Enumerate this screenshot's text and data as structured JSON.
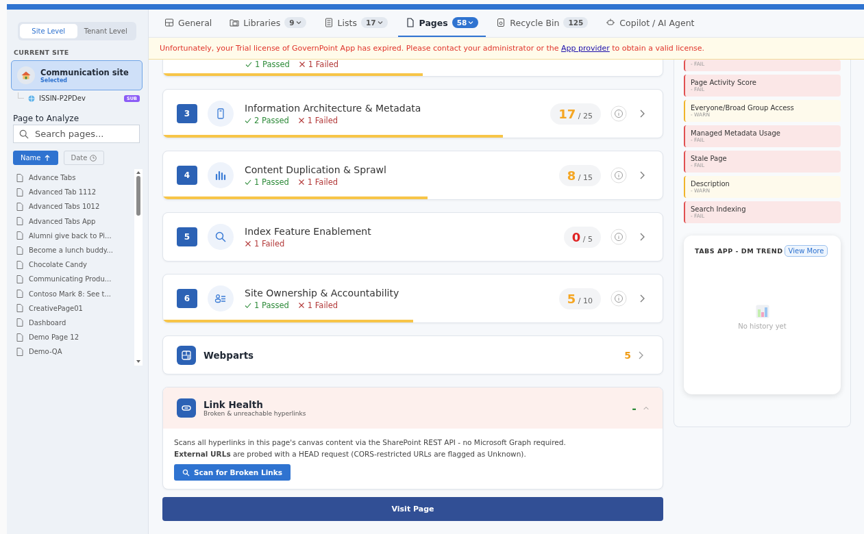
{
  "sidebar": {
    "scope_tabs": [
      {
        "label": "Site Level",
        "selected": true
      },
      {
        "label": "Tenant Level",
        "selected": false
      }
    ],
    "current_site_heading": "CURRENT SITE",
    "site": {
      "name": "Communication site",
      "status": "Selected"
    },
    "subsite": {
      "name": "ISSIN-P2PDev",
      "badge": "SUB"
    },
    "page_heading": "Page to Analyze",
    "search": {
      "placeholder": "Search pages..."
    },
    "sort_buttons": [
      {
        "label": "Name",
        "selected": true
      },
      {
        "label": "Date",
        "selected": false
      }
    ],
    "pages": [
      "Advance Tabs",
      "Advanced Tab 1112",
      "Advanced Tabs 1012",
      "Advanced Tabs App",
      "Alumni give back to Pi...",
      "Become a lunch buddy...",
      "Chocolate Candy",
      "Communicating Produ...",
      "Contoso Mark 8: See t...",
      "CreativePage01",
      "Dashboard",
      "Demo Page 12",
      "Demo-QA"
    ]
  },
  "tabs": [
    {
      "label": "General",
      "selected": false
    },
    {
      "label": "Libraries",
      "count": "9",
      "dropdown": true,
      "selected": false
    },
    {
      "label": "Lists",
      "count": "17",
      "dropdown": true,
      "selected": false
    },
    {
      "label": "Pages",
      "count": "58",
      "dropdown": true,
      "selected": true
    },
    {
      "label": "Recycle Bin",
      "count": "125",
      "dropdown": false,
      "selected": false
    },
    {
      "label": "Copilot / AI Agent",
      "selected": false
    }
  ],
  "banner": {
    "before": "Unfortunately, your Trial license of GovernPoint App has expired. Please contact your administrator or the ",
    "link": "App provider",
    "after": " to obtain a valid license."
  },
  "partial_card": {
    "passed": "1 Passed",
    "failed": "1 Failed",
    "level": 0.52
  },
  "categories": [
    {
      "number": "3",
      "title": "Information Architecture & Metadata",
      "passed": "2 Passed",
      "failed": "1 Failed",
      "score": "17",
      "max": "/ 25",
      "kind": "warn",
      "level": 0.68
    },
    {
      "number": "4",
      "title": "Content Duplication & Sprawl",
      "passed": "1 Passed",
      "failed": "1 Failed",
      "score": "8",
      "max": "/ 15",
      "kind": "warn",
      "level": 0.53
    },
    {
      "number": "5",
      "title": "Index Feature Enablement",
      "failed": "1 Failed",
      "score": "0",
      "max": "/ 5",
      "kind": "fail",
      "level": 0
    },
    {
      "number": "6",
      "title": "Site Ownership & Accountability",
      "passed": "1 Passed",
      "failed": "1 Failed",
      "score": "5",
      "max": "/ 10",
      "kind": "warn",
      "level": 0.5
    }
  ],
  "webparts": {
    "title": "Webparts",
    "count": "5"
  },
  "link_health": {
    "title": "Link Health",
    "subtitle": "Broken & unreachable hyperlinks",
    "value": "-",
    "expanded": true,
    "description_1": "Scans all hyperlinks in this page's canvas content via the SharePoint REST API - no Microsoft Graph required.",
    "description_2": "**External URLs** are probed with a HEAD request (CORS-restricted URLs are flagged as Unknown).",
    "scan_button": "Scan for Broken Links"
  },
  "visit_button": "Visit Page",
  "checks": [
    {
      "status": "- FAIL",
      "kind": "fail"
    },
    {
      "title": "Page Activity Score",
      "status": "- FAIL",
      "kind": "fail"
    },
    {
      "title": "Everyone/Broad Group Access",
      "status": "- WARN",
      "kind": "warn"
    },
    {
      "title": "Managed Metadata Usage",
      "status": "- FAIL",
      "kind": "fail"
    },
    {
      "title": "Stale Page",
      "status": "- FAIL",
      "kind": "fail"
    },
    {
      "title": "Description",
      "status": "- WARN",
      "kind": "warn"
    },
    {
      "title": "Search Indexing",
      "status": "- FAIL",
      "kind": "fail"
    }
  ],
  "trend": {
    "title": "TABS APP - DM TREND",
    "button": "View More",
    "empty": "No history yet"
  }
}
